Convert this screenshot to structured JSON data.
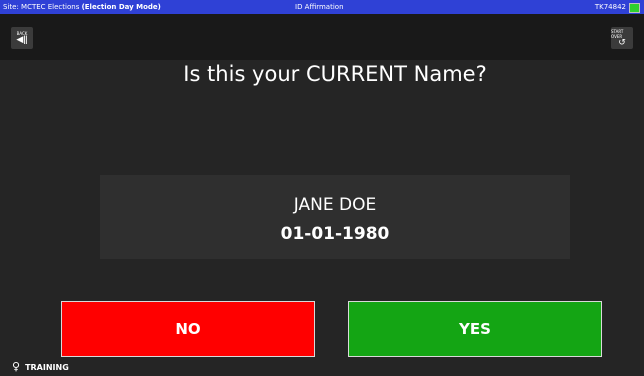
{
  "topbar": {
    "site_prefix": "Site: MCTEC Elections ",
    "mode": "(Election Day Mode)",
    "screen": "ID Affirmation",
    "device_id": "TK74842",
    "battery_color": "#2ed12e",
    "bar_color": "#2f41d6"
  },
  "toolbar": {
    "back_label": "BACK",
    "back_icon": "speaker-icon",
    "start_over_label": "START OVER",
    "start_over_icon": "restart-icon"
  },
  "main": {
    "question": "Is this your CURRENT Name?",
    "voter_name": "JANE DOE",
    "voter_dob": "01-01-1980"
  },
  "actions": {
    "no_label": "NO",
    "no_color": "#ff0000",
    "yes_label": "YES",
    "yes_color": "#14a514"
  },
  "footer": {
    "training_label": "TRAINING",
    "training_icon": "lightbulb-icon"
  }
}
